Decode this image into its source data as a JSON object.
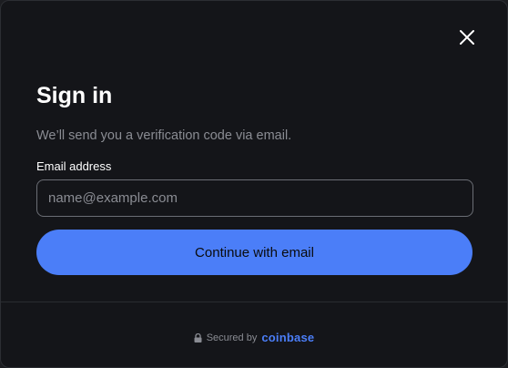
{
  "dialog": {
    "title": "Sign in",
    "subtitle": "We’ll send you a verification code via email.",
    "close_icon": "close-icon"
  },
  "email": {
    "label": "Email address",
    "value": "",
    "placeholder": "name@example.com"
  },
  "continue_label": "Continue with email",
  "footer": {
    "secured_text": "Secured by",
    "brand": "coinbase",
    "lock_icon": "lock-icon"
  },
  "colors": {
    "background": "#141519",
    "accent": "#4b7ef8",
    "muted_text": "#8a8c93"
  }
}
